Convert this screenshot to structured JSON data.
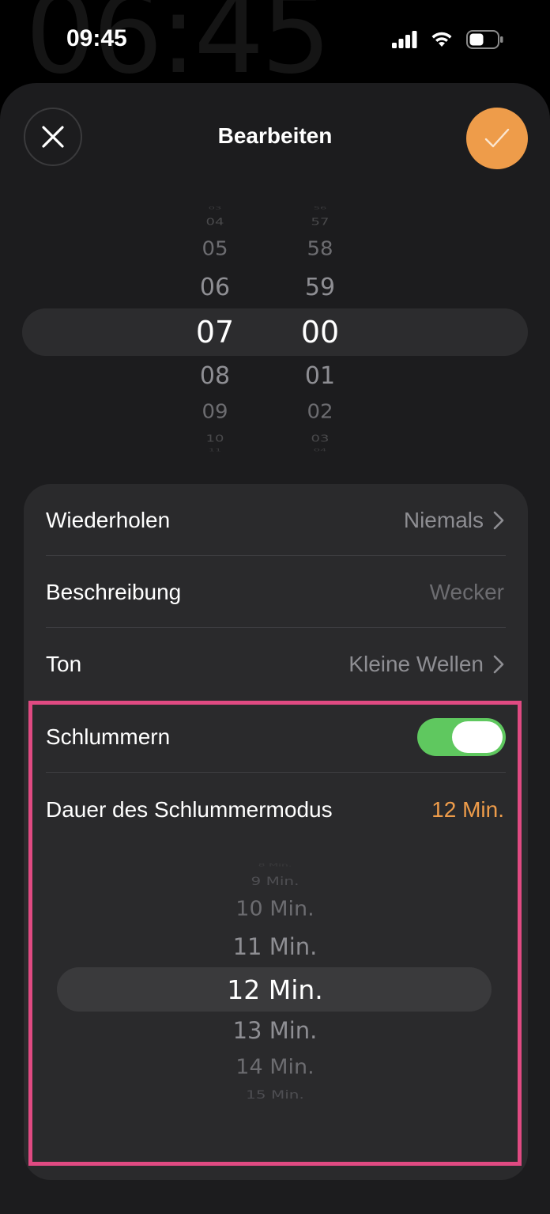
{
  "background": {
    "ghost_time": "06:45"
  },
  "status_bar": {
    "time": "09:45",
    "icons": [
      "signal-icon",
      "wifi-icon",
      "battery-icon"
    ],
    "battery_level": 0.5
  },
  "header": {
    "title": "Bearbeiten",
    "close_icon": "close-icon",
    "confirm_icon": "checkmark-icon",
    "confirm_color": "#ee9c4a"
  },
  "time_picker": {
    "hours": [
      "03",
      "04",
      "05",
      "06",
      "07",
      "08",
      "09",
      "10",
      "11"
    ],
    "minutes": [
      "56",
      "57",
      "58",
      "59",
      "00",
      "01",
      "02",
      "03",
      "04"
    ],
    "selected_hour": "07",
    "selected_minute": "00"
  },
  "settings": {
    "repeat": {
      "label": "Wiederholen",
      "value": "Niemals"
    },
    "description": {
      "label": "Beschreibung",
      "placeholder": "Wecker"
    },
    "sound": {
      "label": "Ton",
      "value": "Kleine Wellen"
    },
    "snooze": {
      "label": "Schlummern",
      "enabled": true,
      "toggle_color": "#5fc85f"
    },
    "snooze_duration": {
      "label": "Dauer des Schlummermodus",
      "value": "12 Min.",
      "value_color": "#ee9c4a"
    }
  },
  "snooze_picker": {
    "items": [
      "8 Min.",
      "9 Min.",
      "10 Min.",
      "11 Min.",
      "12 Min.",
      "13 Min.",
      "14 Min.",
      "15 Min."
    ],
    "selected": "12 Min."
  },
  "highlight_frame_color": "#e04a82"
}
